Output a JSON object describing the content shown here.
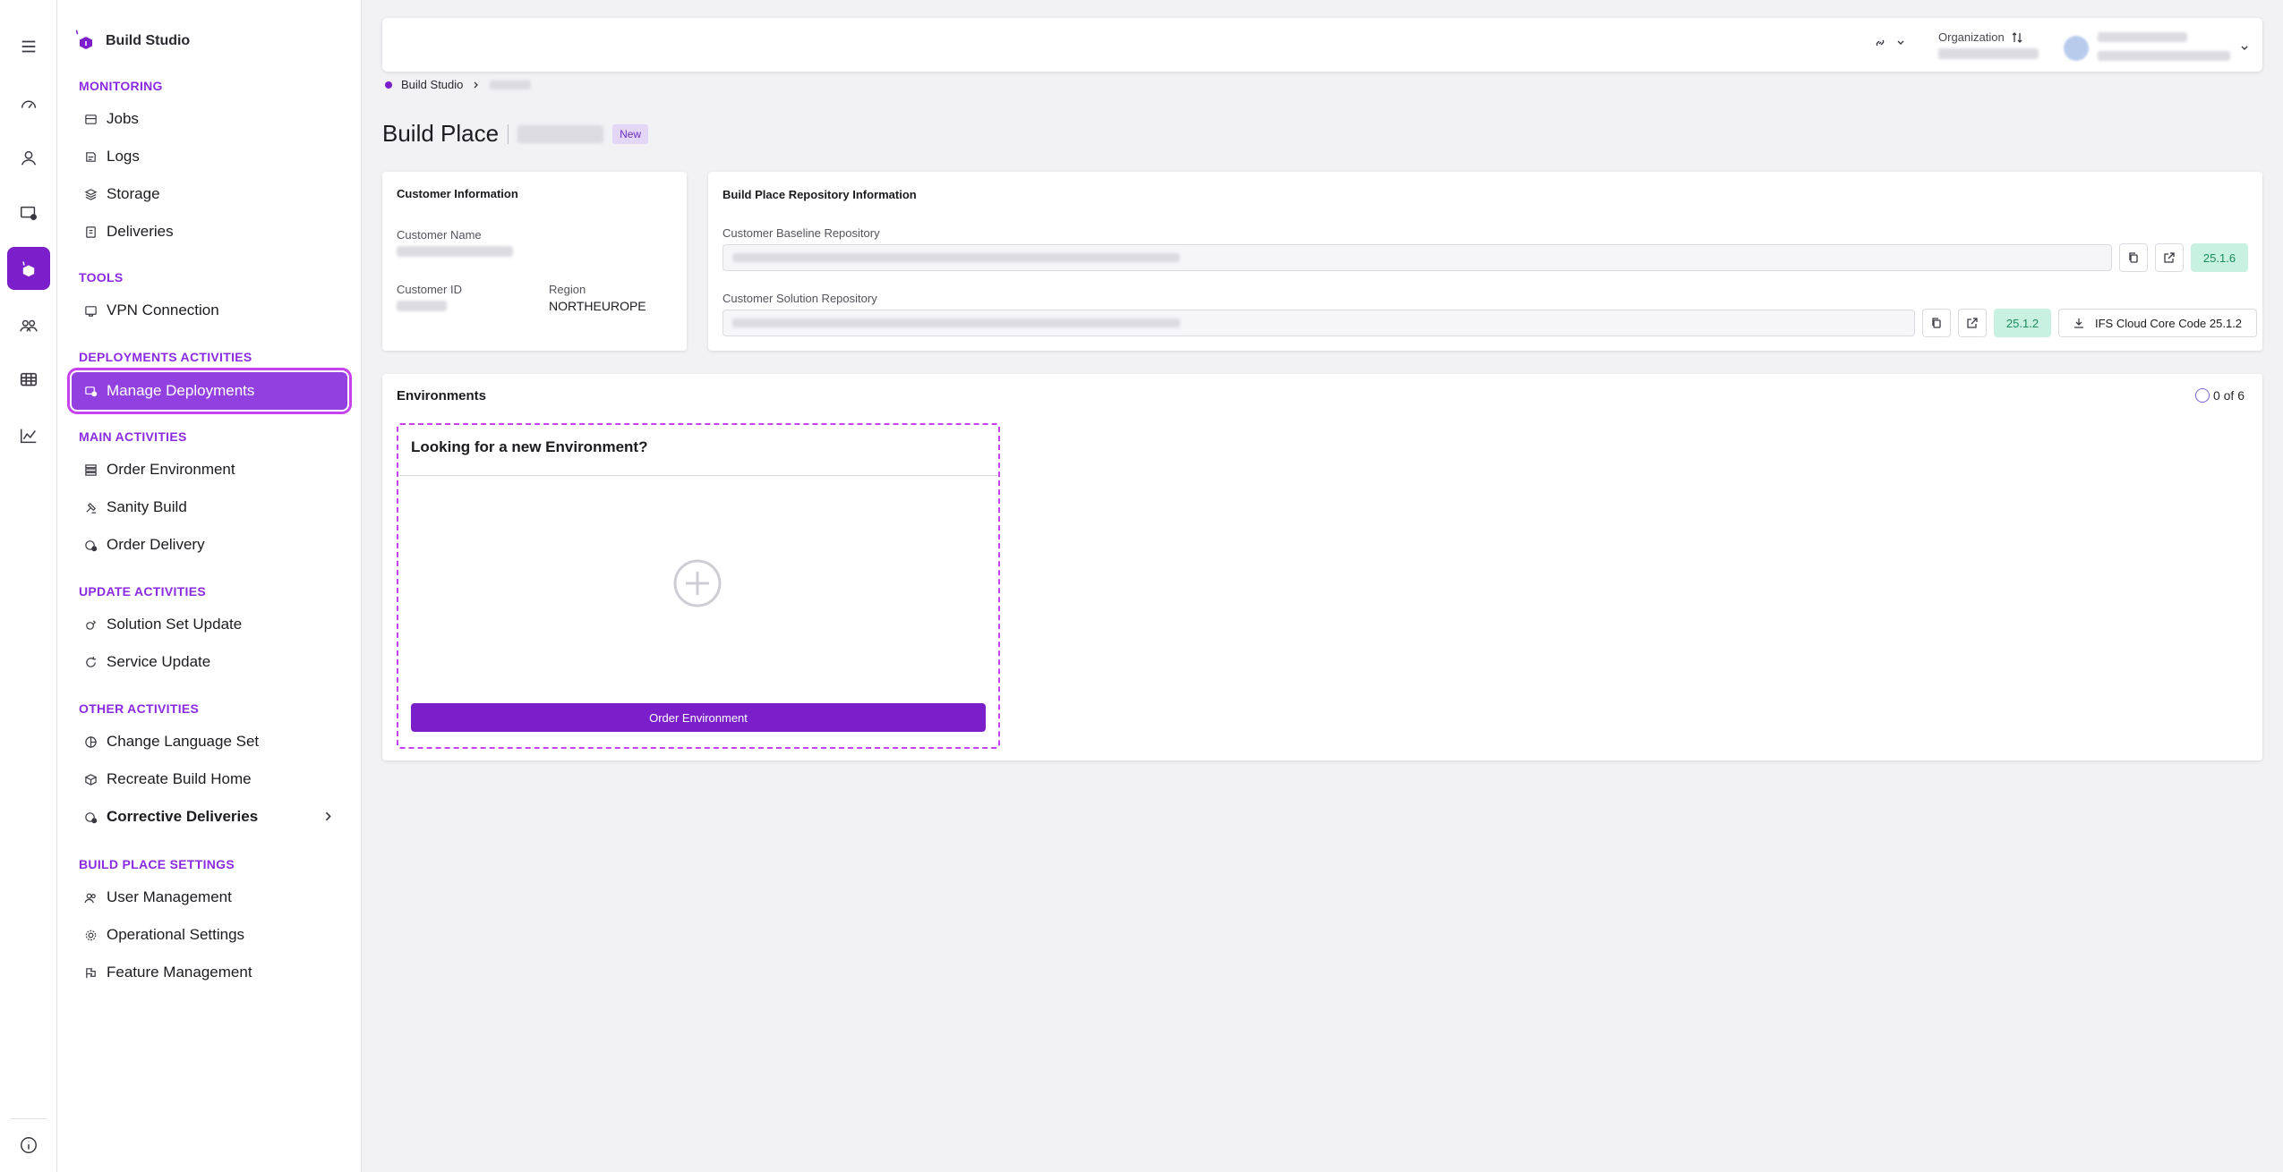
{
  "sidebar": {
    "brand": "Build Studio",
    "sections": {
      "monitoring": "MONITORING",
      "tools": "TOOLS",
      "deployments": "DEPLOYMENTS ACTIVITIES",
      "main": "MAIN ACTIVITIES",
      "update": "UPDATE ACTIVITIES",
      "other": "OTHER ACTIVITIES",
      "settings": "BUILD PLACE SETTINGS"
    },
    "items": {
      "jobs": "Jobs",
      "logs": "Logs",
      "storage": "Storage",
      "deliveries": "Deliveries",
      "vpn": "VPN Connection",
      "manage_deployments": "Manage Deployments",
      "order_environment": "Order Environment",
      "sanity_build": "Sanity Build",
      "order_delivery": "Order Delivery",
      "solution_set_update": "Solution Set Update",
      "service_update": "Service Update",
      "change_language_set": "Change Language Set",
      "recreate_build_home": "Recreate Build Home",
      "corrective_deliveries": "Corrective Deliveries",
      "user_management": "User Management",
      "operational_settings": "Operational Settings",
      "feature_management": "Feature Management"
    },
    "active_item": "Manage Deployments"
  },
  "rail": {
    "icons": [
      "menu-icon",
      "dashboard-gauge-icon",
      "person-icon",
      "deploy-screen-icon",
      "build-studio-icon",
      "team-icon",
      "table-grid-icon",
      "analytics-chart-icon",
      "info-icon"
    ],
    "active": "build-studio-icon"
  },
  "header": {
    "organization_label": "Organization"
  },
  "breadcrumb": {
    "root": "Build Studio"
  },
  "page": {
    "title": "Build Place",
    "badge": "New"
  },
  "customer_info": {
    "title": "Customer Information",
    "name_label": "Customer Name",
    "id_label": "Customer ID",
    "region_label": "Region",
    "region_value": "NORTHEUROPE"
  },
  "repo_info": {
    "title": "Build Place Repository Information",
    "baseline_label": "Customer Baseline Repository",
    "baseline_version": "25.1.6",
    "solution_label": "Customer Solution Repository",
    "solution_version": "25.1.2",
    "download_label": "IFS Cloud Core Code 25.1.2"
  },
  "environments": {
    "title": "Environments",
    "count": "0 of 6",
    "new_card_title": "Looking for a new Environment?",
    "order_button": "Order Environment"
  },
  "colors": {
    "accent": "#7a1fc9",
    "section": "#8a2be2",
    "active_item": "#9340e0",
    "version_badge_bg": "#c9f1e1"
  }
}
